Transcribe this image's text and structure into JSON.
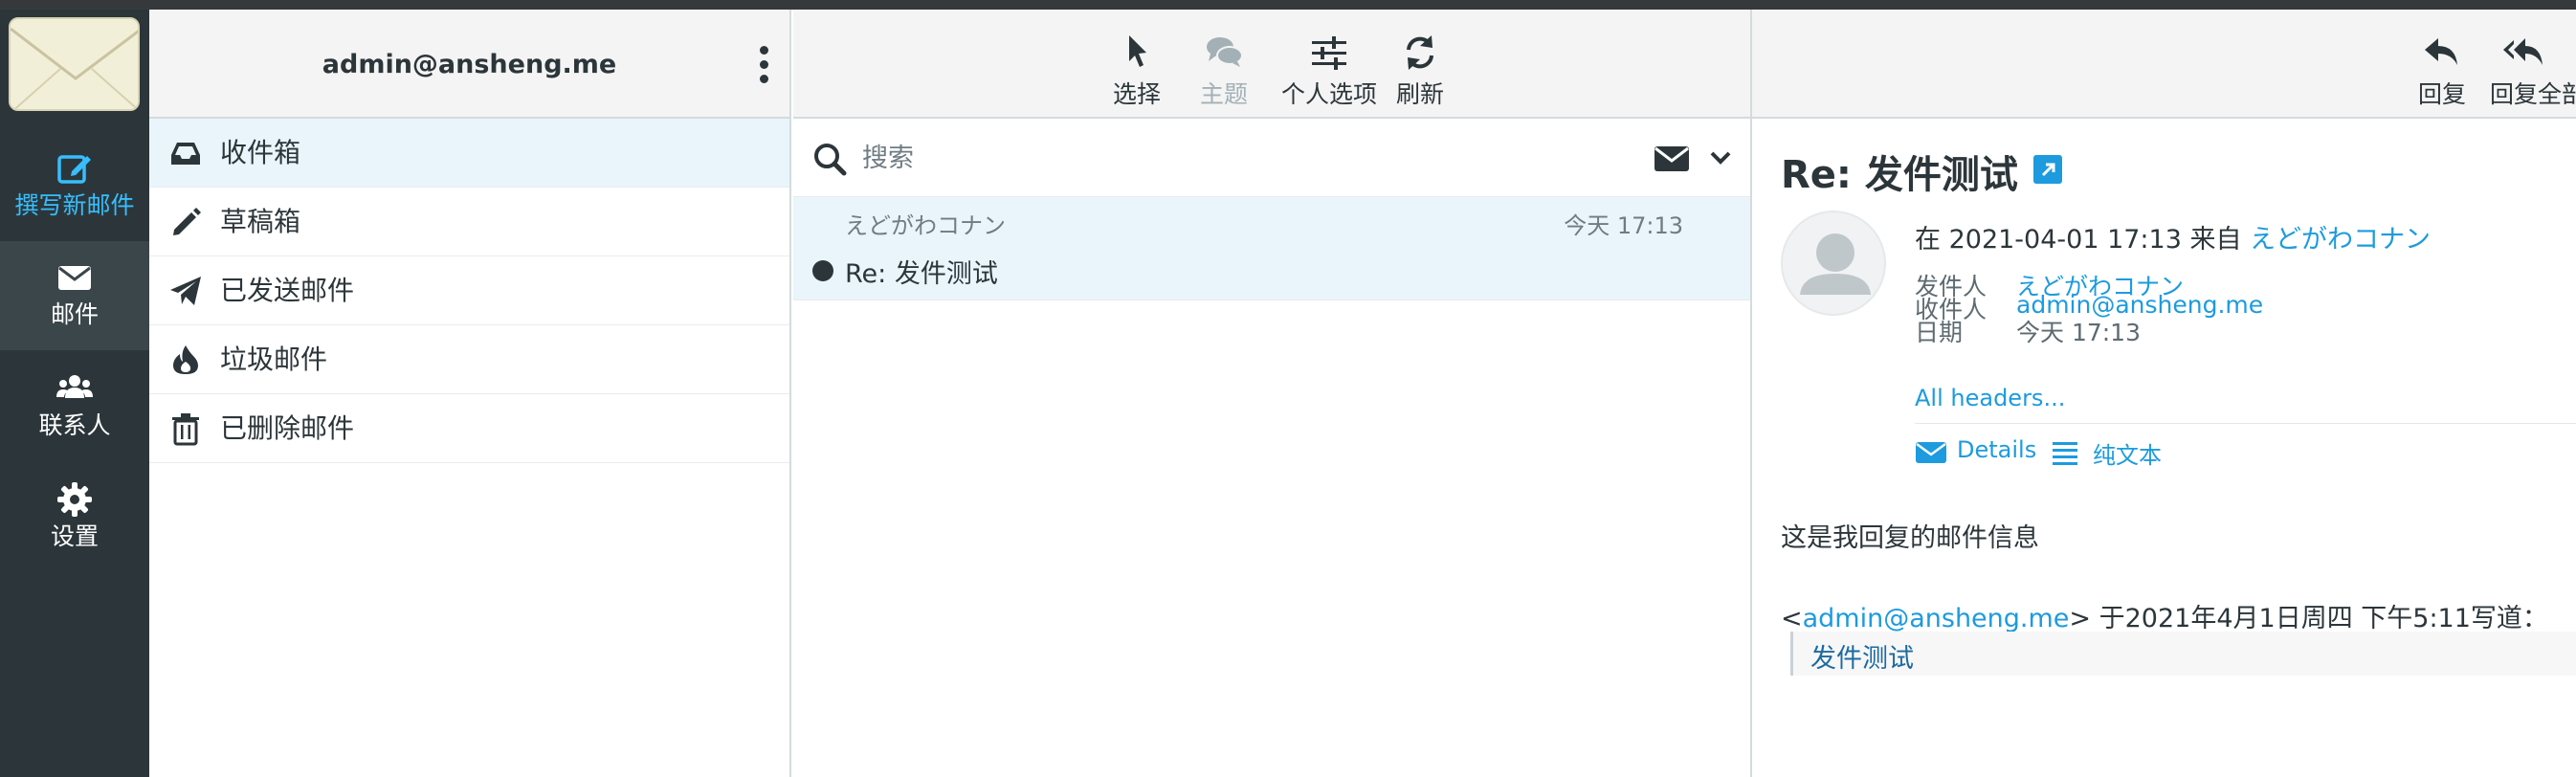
{
  "nav": {
    "compose_label": "撰写新邮件",
    "mail_label": "邮件",
    "contacts_label": "联系人",
    "settings_label": "设置",
    "accent_color": "#37beff",
    "background_color": "#2c363a"
  },
  "folders": {
    "account": "admin@ansheng.me",
    "items": [
      {
        "label": "收件箱",
        "icon": "inbox-icon",
        "active": true
      },
      {
        "label": "草稿箱",
        "icon": "pencil-icon"
      },
      {
        "label": "已发送邮件",
        "icon": "paper-plane-icon"
      },
      {
        "label": "垃圾邮件",
        "icon": "fire-icon"
      },
      {
        "label": "已删除邮件",
        "icon": "trash-icon"
      }
    ]
  },
  "toolbar": {
    "select_label": "选择",
    "thread_label": "主题",
    "options_label": "个人选项",
    "refresh_label": "刷新",
    "reply_label": "回复",
    "reply_all_label": "回复全部"
  },
  "search": {
    "placeholder": "搜索"
  },
  "messages": [
    {
      "from": "えどがわコナン",
      "date": "今天 17:13",
      "subject": "Re: 发件测试",
      "unread": true
    }
  ],
  "preview": {
    "subject": "Re: 发件测试",
    "summary_prefix": "在 2021-04-01 17:13 来自 ",
    "summary_sender": "えどがわコナン",
    "from_label": "发件人",
    "from_value": "えどがわコナン",
    "to_label": "收件人",
    "to_value": "admin@ansheng.me",
    "date_label": "日期",
    "date_value": "今天 17:13",
    "all_headers": "All headers...",
    "details_label": "Details",
    "plaintext_label": "纯文本",
    "body": "这是我回复的邮件信息",
    "quote_open": "<",
    "quote_email": "admin@ansheng.me",
    "quote_close": "> 于2021年4月1日周四 下午5:11写道：",
    "quote_text": "发件测试"
  }
}
